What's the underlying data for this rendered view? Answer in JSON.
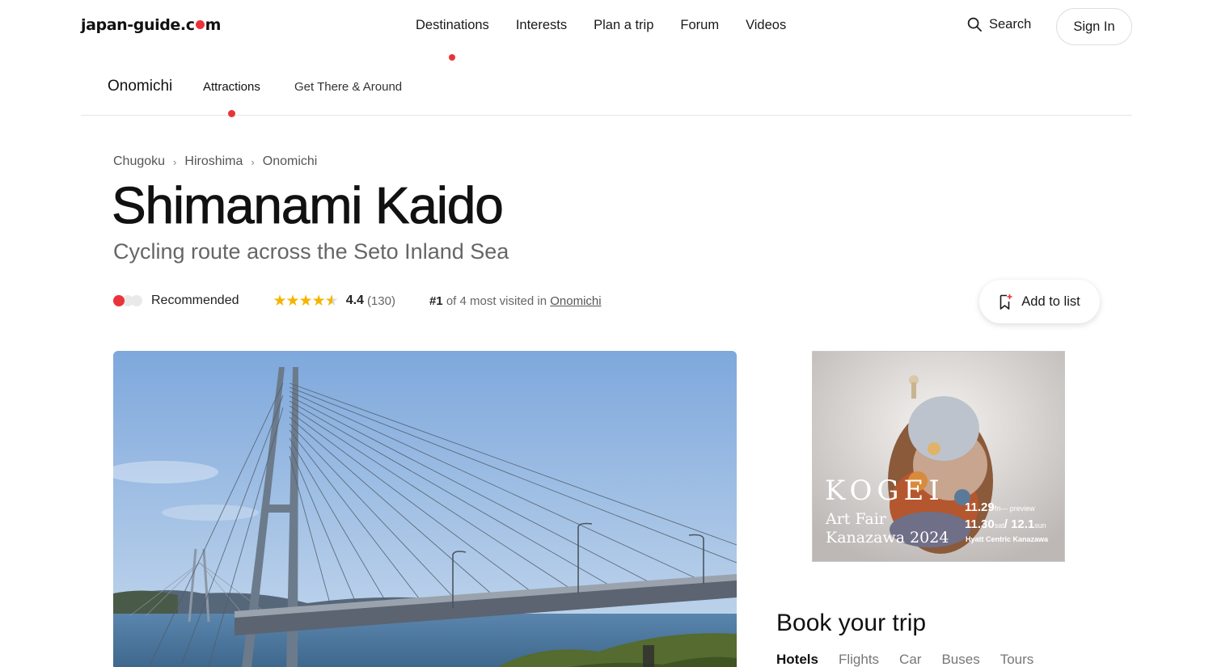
{
  "header": {
    "logo_text": "japan-guide.com",
    "nav": [
      "Destinations",
      "Interests",
      "Plan a trip",
      "Forum",
      "Videos"
    ],
    "search_label": "Search",
    "signin_label": "Sign In"
  },
  "subnav": {
    "place": "Onomichi",
    "tabs": [
      "Attractions",
      "Get There & Around"
    ]
  },
  "breadcrumb": [
    "Chugoku",
    "Hiroshima",
    "Onomichi"
  ],
  "title": "Shimanami Kaido",
  "subtitle": "Cycling route across the Seto Inland Sea",
  "meta": {
    "recommendation": "Recommended",
    "stars": "★★★★",
    "half_star": "★",
    "rating": "4.4",
    "review_count": "(130)",
    "rank_num": "#1",
    "rank_text": " of 4 most visited in ",
    "rank_place": "Onomichi"
  },
  "add_to_list_label": "Add to list",
  "ad": {
    "title": "KOGEI",
    "sub_line1": "Art Fair",
    "sub_line2": "Kanazawa 2024",
    "date1_main": "11.29",
    "date1_day": "fri",
    "date1_note": "— preview",
    "date2_main": "11.30",
    "date2_day": "sat",
    "date2_end": "/ 12.1",
    "date2_day2": "sun",
    "venue": "Hyatt Centric Kanazawa"
  },
  "booking": {
    "title": "Book your trip",
    "tabs": [
      "Hotels",
      "Flights",
      "Car",
      "Buses",
      "Tours"
    ]
  },
  "colors": {
    "accent": "#ea3339",
    "star": "#f5b400",
    "sky": "#8fb4de"
  }
}
